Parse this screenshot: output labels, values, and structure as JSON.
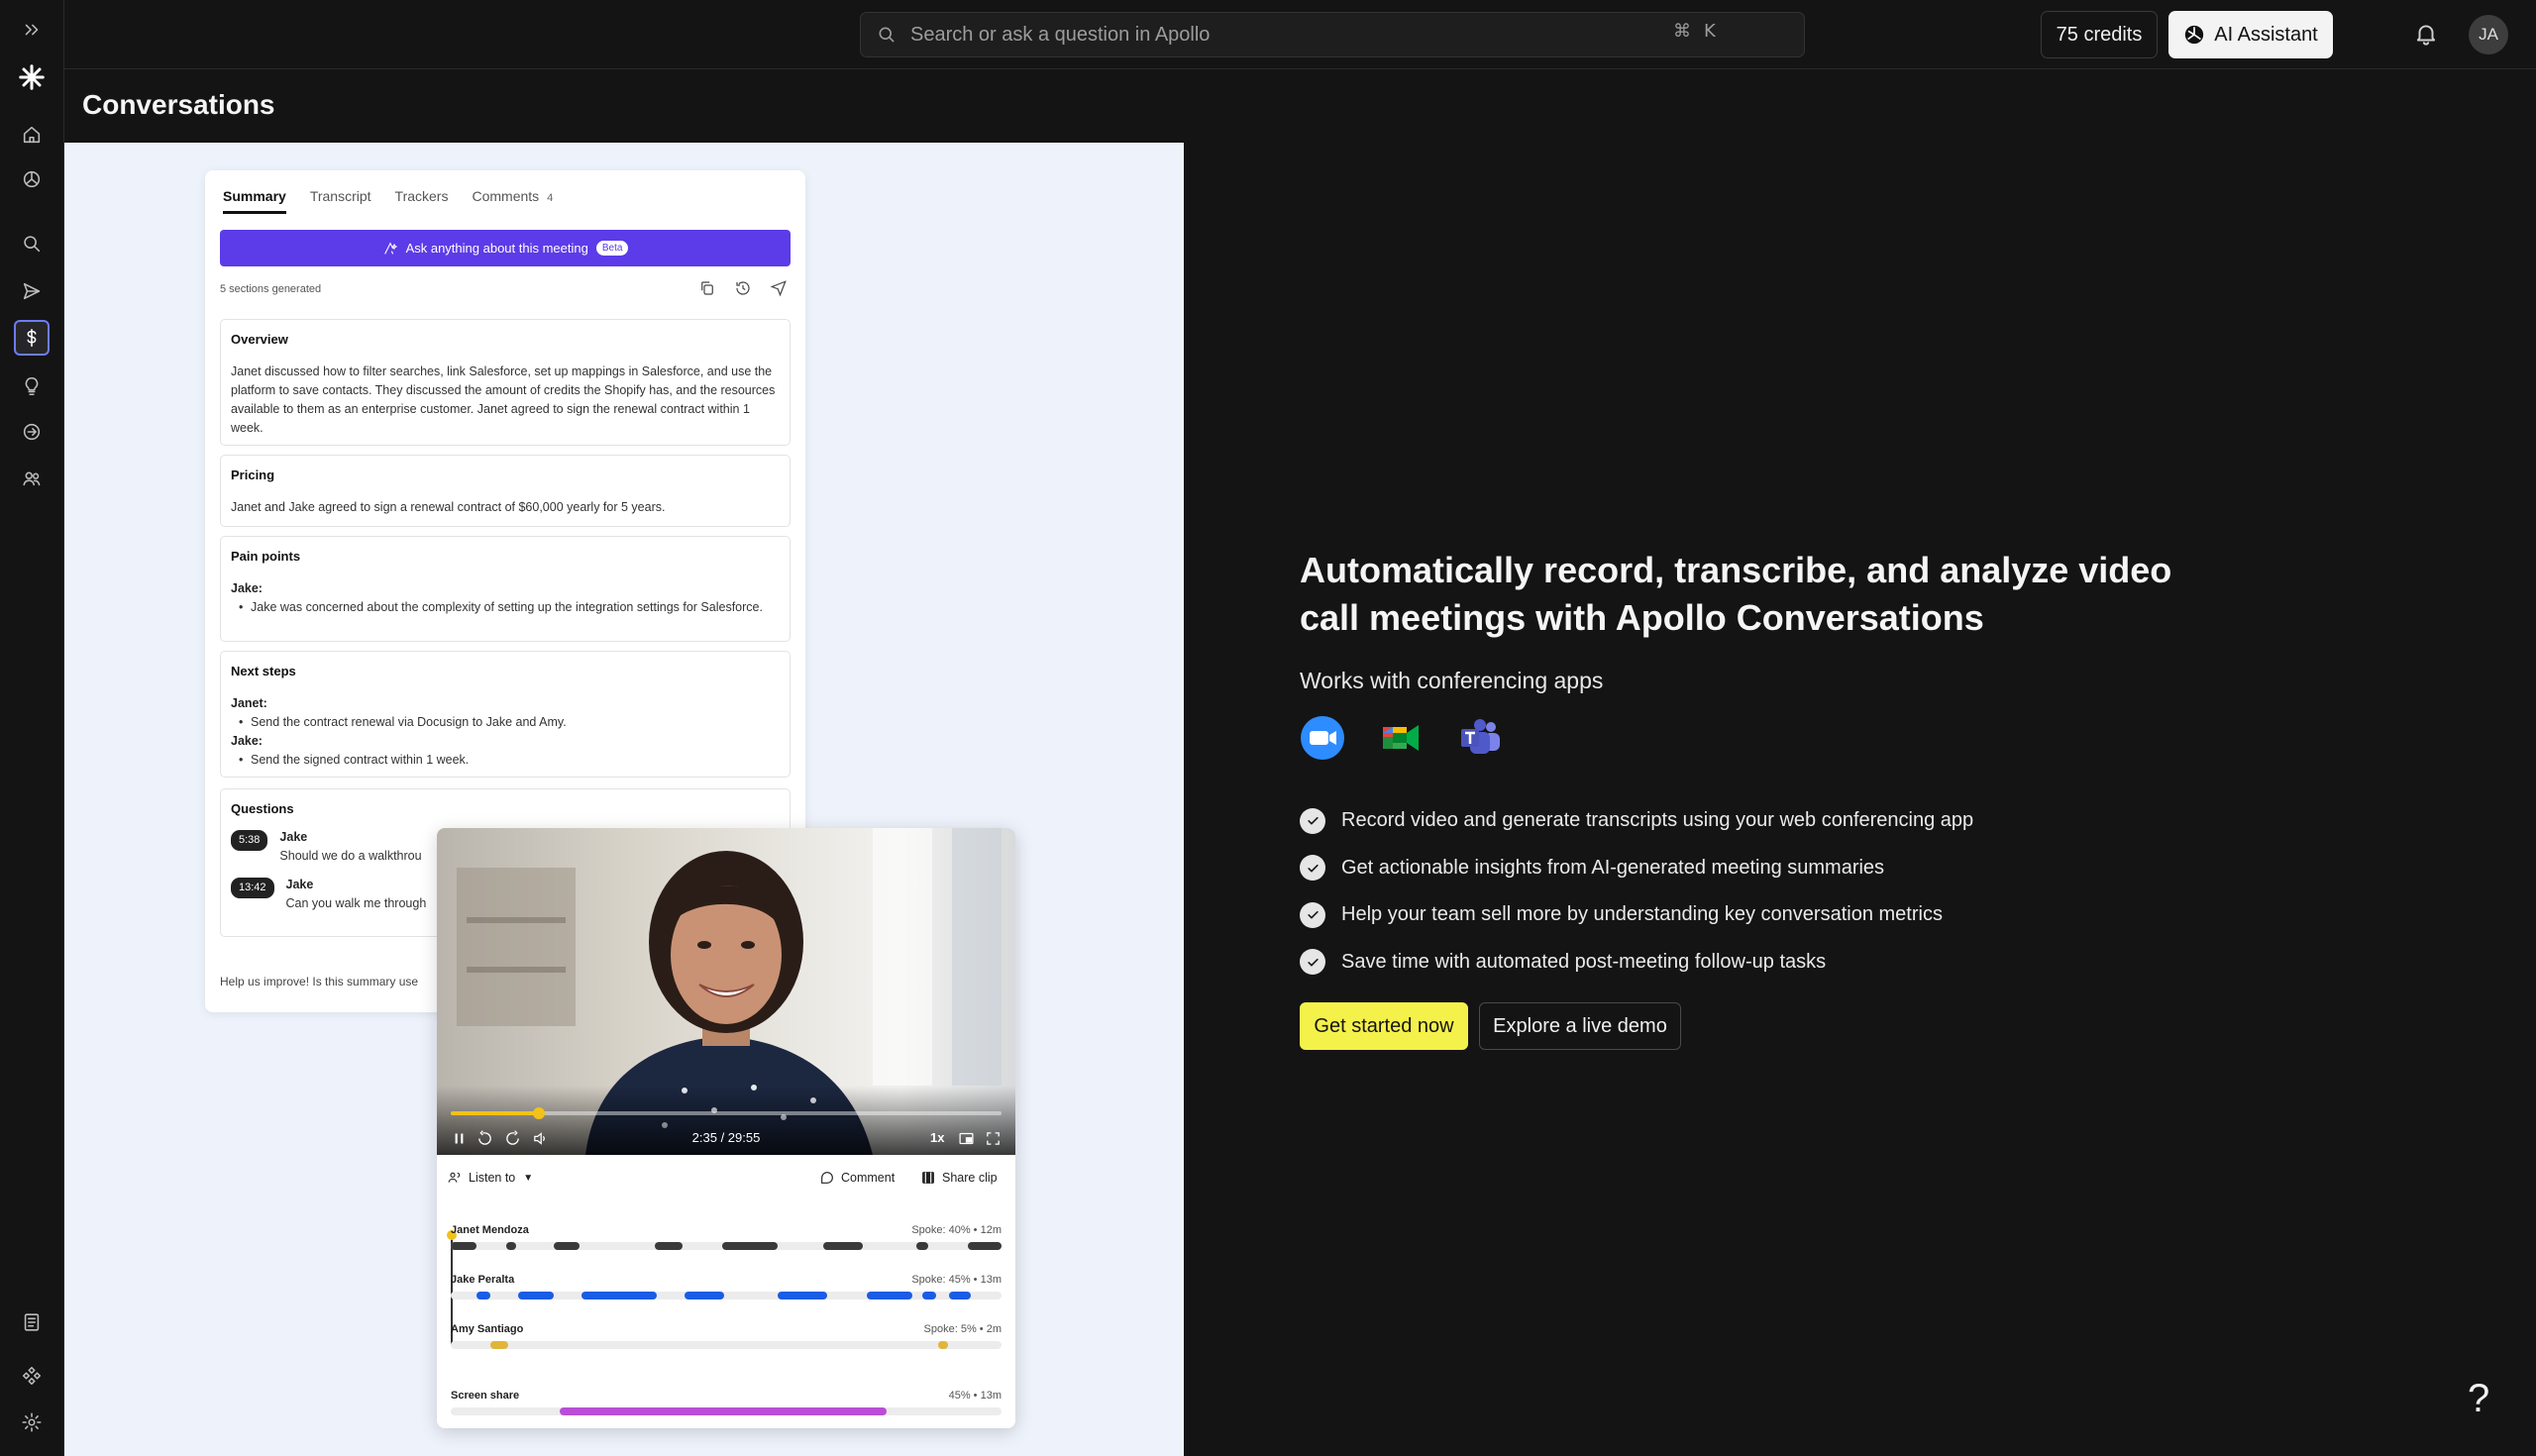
{
  "topbar": {
    "search_placeholder": "Search or ask a question in Apollo",
    "shortcut_cmd": "⌘",
    "shortcut_key": "K",
    "credits": "75 credits",
    "ai_assistant": "AI Assistant",
    "avatar_initials": "JA"
  },
  "page": {
    "title": "Conversations"
  },
  "summary_card": {
    "tabs": [
      "Summary",
      "Transcript",
      "Trackers",
      "Comments"
    ],
    "comments_count": "4",
    "ask_bar": "Ask anything about this meeting",
    "beta_badge": "Beta",
    "sections_generated": "5 sections generated",
    "overview_title": "Overview",
    "overview_text": "Janet discussed how to filter searches, link Salesforce, set up mappings in Salesforce, and use the platform to save contacts. They discussed the amount of credits the Shopify has, and the resources available to them as an enterprise customer. Janet agreed to sign the renewal contract within 1 week.",
    "pricing_title": "Pricing",
    "pricing_text": "Janet and Jake agreed to sign a renewal contract of $60,000 yearly for 5 years.",
    "pain_title": "Pain points",
    "pain_who": "Jake:",
    "pain_item": "Jake was concerned about the complexity of setting up the integration settings for Salesforce.",
    "next_title": "Next steps",
    "next_who1": "Janet:",
    "next_item1": "Send the contract renewal via Docusign to Jake and Amy.",
    "next_who2": "Jake:",
    "next_item2": "Send the signed contract within 1 week.",
    "questions_title": "Questions",
    "q1_time": "5:38",
    "q1_name": "Jake",
    "q1_text": "Should we do a walkthrou",
    "q2_time": "13:42",
    "q2_name": "Jake",
    "q2_text": "Can you walk me through",
    "feedback": "Help us improve! Is this summary use"
  },
  "video_card": {
    "time": "2:35 / 29:55",
    "speed": "1x",
    "progress": 0.16,
    "listen_to": "Listen to",
    "comment": "Comment",
    "share_clip": "Share clip",
    "speakers": [
      {
        "name": "Janet Mendoza",
        "stats": "Spoke: 40%  •  12m",
        "color": "#3a3a3a"
      },
      {
        "name": "Jake Peralta",
        "stats": "Spoke: 45%  •  13m",
        "color": "#1a5ce6"
      },
      {
        "name": "Amy Santiago",
        "stats": "Spoke: 5%  •  2m",
        "color": "#e0b53a"
      },
      {
        "name": "Screen share",
        "stats": "45%  •  13m",
        "color": "#b94ed6"
      }
    ]
  },
  "marketing": {
    "headline": "Automatically record, transcribe, and analyze video call meetings with Apollo Conversations",
    "works_with": "Works with conferencing apps",
    "features": [
      "Record video and generate transcripts using your web conferencing app",
      "Get actionable insights from AI-generated meeting summaries",
      "Help your team sell more by understanding key conversation metrics",
      "Save time with automated post-meeting follow-up tasks"
    ],
    "cta_primary": "Get started now",
    "cta_secondary": "Explore a live demo"
  },
  "help_glyph": "?",
  "colors": {
    "accent_purple": "#5b3ce8",
    "cta_yellow": "#f5f14b",
    "active_nav": "#6c7cff"
  }
}
